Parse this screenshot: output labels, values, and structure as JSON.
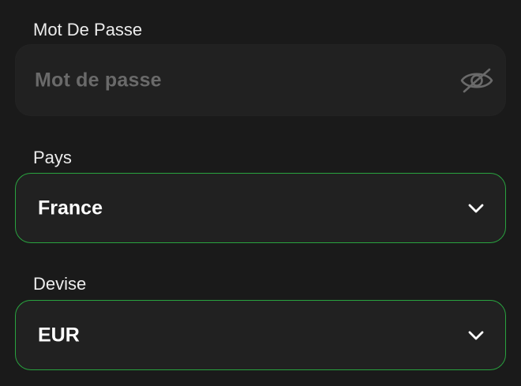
{
  "password": {
    "label": "Mot De Passe",
    "placeholder": "Mot de passe",
    "value": "",
    "toggle_icon": "eye-slash-icon"
  },
  "country": {
    "label": "Pays",
    "selected": "France",
    "icon": "chevron-down-icon"
  },
  "currency": {
    "label": "Devise",
    "selected": "EUR",
    "icon": "chevron-down-icon"
  },
  "colors": {
    "background": "#1a1a1a",
    "field_background": "#212121",
    "focus_border": "#29a33f",
    "label_text": "#ececec",
    "placeholder_text": "#6a6a6a",
    "value_text": "#ffffff"
  }
}
